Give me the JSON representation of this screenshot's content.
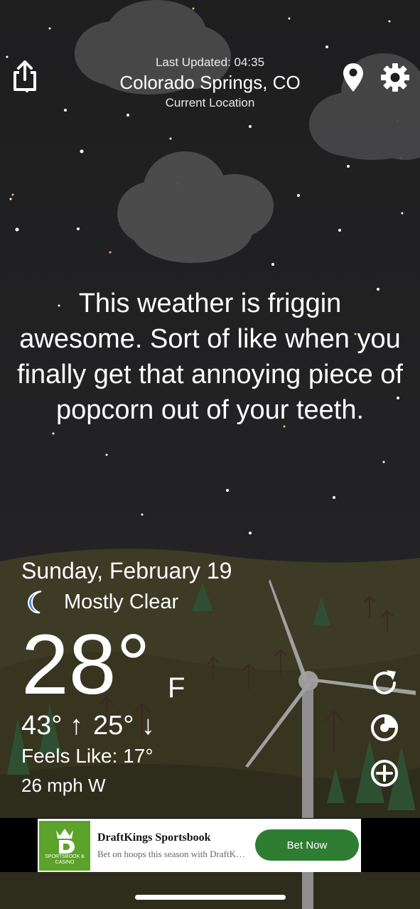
{
  "header": {
    "last_updated": "Last Updated: 04:35",
    "city": "Colorado Springs, CO",
    "location_label": "Current Location"
  },
  "icons": {
    "share": "share-icon",
    "location": "location-pin-icon",
    "settings": "gear-icon",
    "refresh": "refresh-icon",
    "radar": "radar-icon",
    "add": "plus-circle-icon",
    "condition": "moon-icon"
  },
  "quote": "This weather is friggin awesome. Sort of like when you finally get that annoying piece of popcorn out of your teeth.",
  "weather": {
    "date": "Sunday, February 19",
    "condition": "Mostly Clear",
    "temperature": "28°",
    "unit": "F",
    "high": "43° ↑",
    "low": "25° ↓",
    "feels_like": "Feels Like: 17°",
    "wind": "26 mph W"
  },
  "ad": {
    "title": "DraftKings Sportsbook",
    "subtitle": "Bet on hoops this season with DraftKings",
    "cta": "Bet Now",
    "logo_text": "SPORTSBOOK & CASINO"
  },
  "colors": {
    "background": "#1e1e1f",
    "ad_button": "#2f7d32",
    "logo_green": "#5ba32a"
  }
}
